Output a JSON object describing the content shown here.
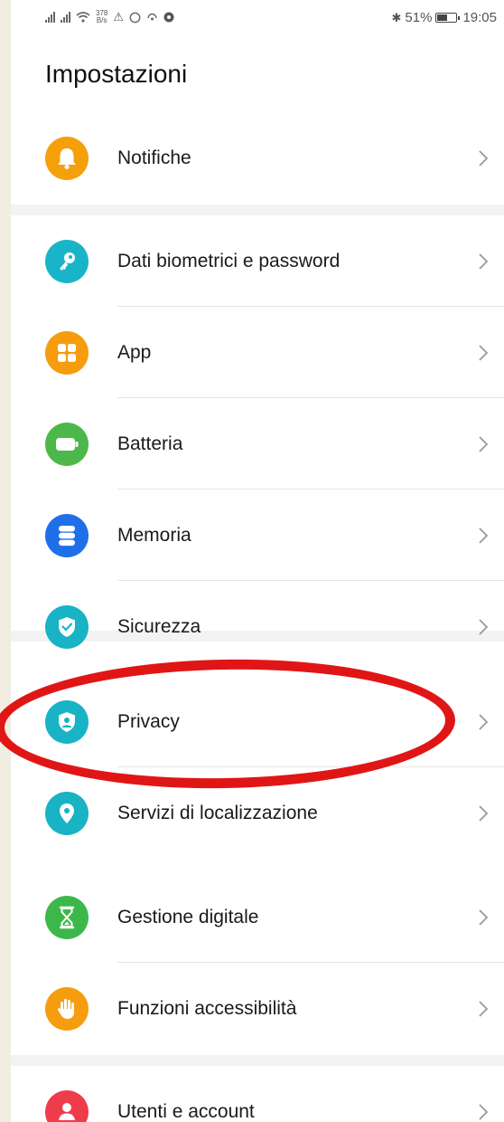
{
  "status_bar": {
    "net_speed_value": "378",
    "net_speed_unit": "B/s",
    "battery_percent": "51%",
    "battery_level": 0.51,
    "time": "19:05"
  },
  "page_title": "Impostazioni",
  "items": [
    {
      "label": "Notifiche",
      "icon": "bell-icon",
      "color": "#f5a00b"
    },
    {
      "label": "Dati biometrici e password",
      "icon": "key-icon",
      "color": "#1ab4c8"
    },
    {
      "label": "App",
      "icon": "apps-grid-icon",
      "color": "#f59d0f"
    },
    {
      "label": "Batteria",
      "icon": "battery-icon",
      "color": "#4cb84a"
    },
    {
      "label": "Memoria",
      "icon": "storage-icon",
      "color": "#1f6fe8"
    },
    {
      "label": "Sicurezza",
      "icon": "shield-check-icon",
      "color": "#18b3c4"
    },
    {
      "label": "Privacy",
      "icon": "privacy-shield-icon",
      "color": "#18b3c4"
    },
    {
      "label": "Servizi di localizzazione",
      "icon": "location-pin-icon",
      "color": "#18b3c4"
    },
    {
      "label": "Gestione digitale",
      "icon": "hourglass-icon",
      "color": "#3cb84a"
    },
    {
      "label": "Funzioni accessibilità",
      "icon": "hand-icon",
      "color": "#f59d0f"
    },
    {
      "label": "Utenti e account",
      "icon": "user-icon",
      "color": "#ee3c4c"
    }
  ],
  "highlight_color": "#e01616"
}
